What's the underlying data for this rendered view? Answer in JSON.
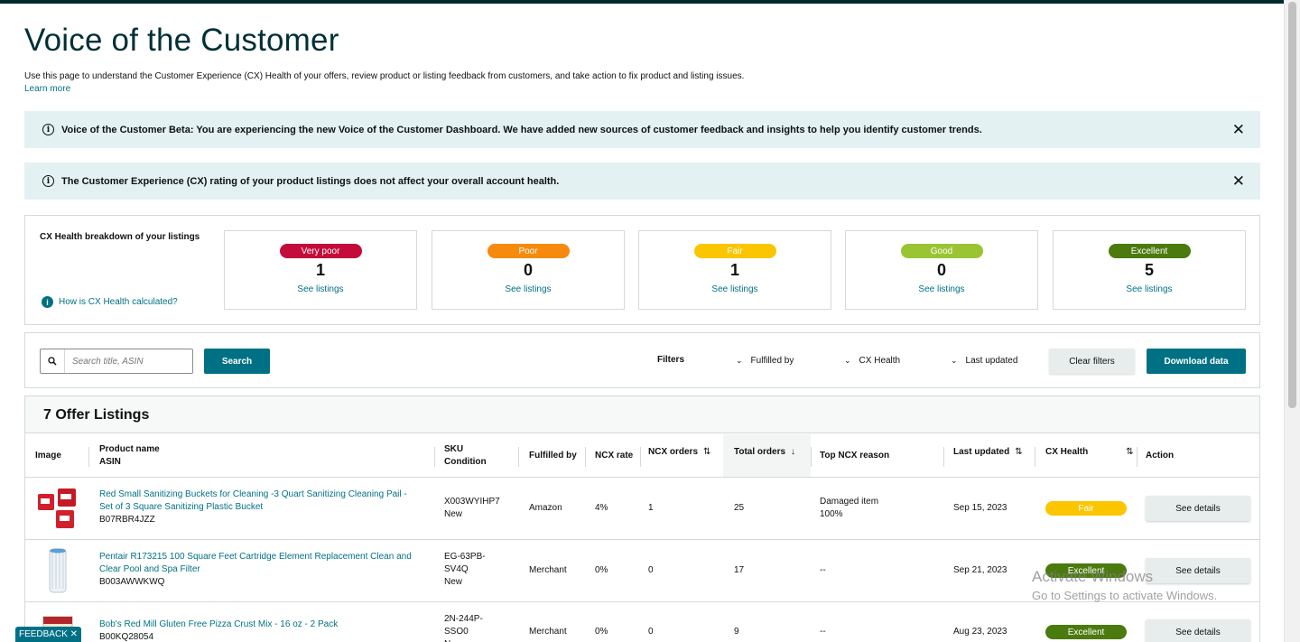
{
  "header": {
    "title": "Voice of the Customer",
    "description": "Use this page to understand the Customer Experience (CX) Health of your offers, review product or listing feedback from customers, and take action to fix product and listing issues.",
    "learn_more": "Learn more"
  },
  "banners": [
    {
      "text": "Voice of the Customer Beta: You are experiencing the new Voice of the Customer Dashboard. We have added new sources of customer feedback and insights to help you identify customer trends.",
      "close": "✕"
    },
    {
      "text": "The Customer Experience (CX) rating of your product listings does not affect your overall account health.",
      "close": "✕"
    }
  ],
  "health": {
    "label": "CX Health breakdown of your listings",
    "how_link": "How is CX Health calculated?",
    "cards": [
      {
        "rating": "Very poor",
        "count": "1",
        "link": "See listings",
        "color": "#c40c3a"
      },
      {
        "rating": "Poor",
        "count": "0",
        "link": "See listings",
        "color": "#f68a0d"
      },
      {
        "rating": "Fair",
        "count": "1",
        "link": "See listings",
        "color": "#fbc500"
      },
      {
        "rating": "Good",
        "count": "0",
        "link": "See listings",
        "color": "#9ac434"
      },
      {
        "rating": "Excellent",
        "count": "5",
        "link": "See listings",
        "color": "#4b7a0f"
      }
    ]
  },
  "filters": {
    "search_placeholder": "Search title, ASIN",
    "search_button": "Search",
    "filters_label": "Filters",
    "dropdowns": [
      "Fulfilled by",
      "CX Health",
      "Last updated"
    ],
    "clear_button": "Clear filters",
    "download_button": "Download data"
  },
  "table": {
    "count_title": "7 Offer Listings",
    "headers": {
      "image": "Image",
      "product_name": "Product name",
      "asin": "ASIN",
      "sku": "SKU",
      "condition": "Condition",
      "fulfilled_by": "Fulfilled by",
      "ncx_rate": "NCX rate",
      "ncx_orders": "NCX orders",
      "total_orders": "Total orders",
      "top_reason": "Top NCX reason",
      "last_updated": "Last updated",
      "cx_health": "CX Health",
      "action": "Action"
    },
    "rows": [
      {
        "title1": "Red Small Sanitizing Buckets for Cleaning -3 Quart Sanitizing Cleaning Pail -",
        "title2": "Set of 3 Square Sanitizing Plastic Bucket",
        "asin": "B07RBR4JZZ",
        "sku1": "X003WYIHP7",
        "sku2": "New",
        "sku3": "",
        "fulfilled_by": "Amazon",
        "ncx_rate": "4%",
        "ncx_orders": "1",
        "total_orders": "25",
        "reason1": "Damaged item",
        "reason2": "100%",
        "last_updated": "Sep 15, 2023",
        "cx_health": "Fair",
        "cx_color": "#fbc500",
        "action": "See details",
        "image_icon": "red-bucket-image"
      },
      {
        "title1": "Pentair R173215 100 Square Feet Cartridge Element Replacement Clean and",
        "title2": "Clear Pool and Spa Filter",
        "asin": "B003AWWKWQ",
        "sku1": "EG-63PB-",
        "sku2": "SV4Q",
        "sku3": "New",
        "fulfilled_by": "Merchant",
        "ncx_rate": "0%",
        "ncx_orders": "0",
        "total_orders": "17",
        "reason1": "--",
        "reason2": "",
        "last_updated": "Sep 21, 2023",
        "cx_health": "Excellent",
        "cx_color": "#4b7a0f",
        "action": "See details",
        "image_icon": "pool-filter-image"
      },
      {
        "title1": "Bob's Red Mill Gluten Free Pizza Crust Mix - 16 oz - 2 Pack",
        "title2": "",
        "asin": "B00KQ28054",
        "sku1": "2N-244P-",
        "sku2": "SSO0",
        "sku3": "N",
        "fulfilled_by": "Merchant",
        "ncx_rate": "0%",
        "ncx_orders": "0",
        "total_orders": "9",
        "reason1": "--",
        "reason2": "",
        "last_updated": "Aug 23, 2023",
        "cx_health": "Excellent",
        "cx_color": "#4b7a0f",
        "action": "See details",
        "image_icon": "pizza-mix-image"
      }
    ]
  },
  "watermark": {
    "line1": "Activate Windows",
    "line2": "Go to Settings to activate Windows."
  },
  "feedback": "FEEDBACK ✕"
}
